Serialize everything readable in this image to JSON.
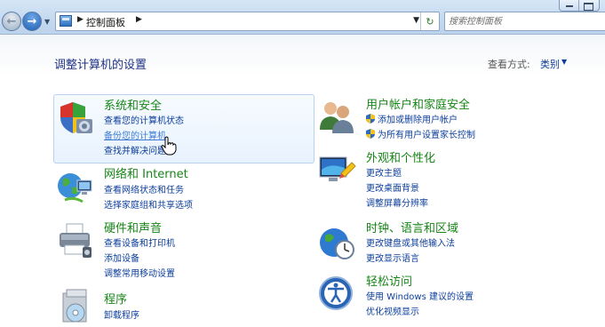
{
  "breadcrumb": {
    "item": "控制面板"
  },
  "search": {
    "placeholder": "搜索控制面板"
  },
  "main": {
    "title": "调整计算机的设置",
    "view_by_label": "查看方式:",
    "view_by_value": "类别"
  },
  "categories": {
    "system_security": {
      "title": "系统和安全",
      "links": [
        "查看您的计算机状态",
        "备份您的计算机",
        "查找并解决问题"
      ]
    },
    "network": {
      "title": "网络和 Internet",
      "links": [
        "查看网络状态和任务",
        "选择家庭组和共享选项"
      ]
    },
    "hardware": {
      "title": "硬件和声音",
      "links": [
        "查看设备和打印机",
        "添加设备",
        "调整常用移动设置"
      ]
    },
    "programs": {
      "title": "程序",
      "links": [
        "卸载程序"
      ]
    },
    "user_accounts": {
      "title": "用户帐户和家庭安全",
      "links": [
        "添加或删除用户帐户",
        "为所有用户设置家长控制"
      ]
    },
    "appearance": {
      "title": "外观和个性化",
      "links": [
        "更改主题",
        "更改桌面背景",
        "调整屏幕分辨率"
      ]
    },
    "clock": {
      "title": "时钟、语言和区域",
      "links": [
        "更改键盘或其他输入法",
        "更改显示语言"
      ]
    },
    "ease": {
      "title": "轻松访问",
      "links": [
        "使用 Windows 建议的设置",
        "优化视频显示"
      ]
    }
  },
  "colors": {
    "title_green": "#178517",
    "link_blue": "#0c3e9b",
    "header_blue": "#1e3287"
  }
}
